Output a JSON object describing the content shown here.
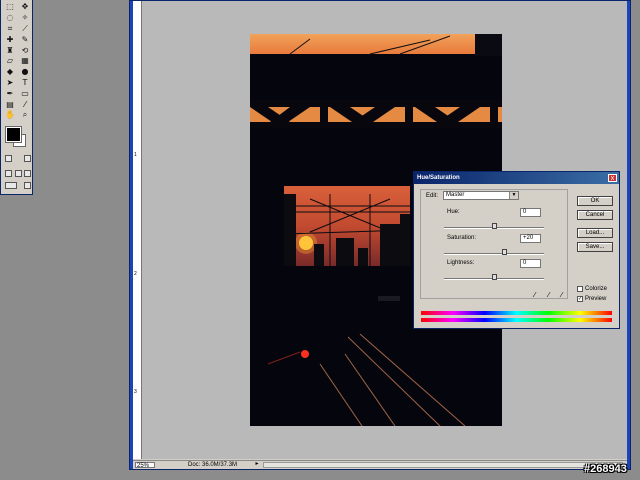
{
  "tools": {
    "icons": [
      "move-tool",
      "lasso-tool",
      "crop-tool",
      "brush-tool",
      "eraser-tool",
      "blur-tool",
      "path-tool",
      "pen-tool",
      "hand-tool",
      "zoom-tool"
    ]
  },
  "rulers": {
    "marks": [
      "1",
      "2",
      "3"
    ]
  },
  "status": {
    "zoom": "25%",
    "doc_size": "Doc: 36.0M/37.3M"
  },
  "dialog": {
    "title": "Hue/Saturation",
    "close_label": "x",
    "edit_label": "Edit:",
    "edit_value": "Master",
    "hue_label": "Hue:",
    "hue_value": "0",
    "saturation_label": "Saturation:",
    "saturation_value": "+20",
    "lightness_label": "Lightness:",
    "lightness_value": "0",
    "ok_label": "OK",
    "cancel_label": "Cancel",
    "load_label": "Load...",
    "save_label": "Save...",
    "colorize_label": "Colorize",
    "preview_label": "Preview",
    "colorize_checked": false,
    "preview_checked": true
  },
  "watermark": "#268943"
}
